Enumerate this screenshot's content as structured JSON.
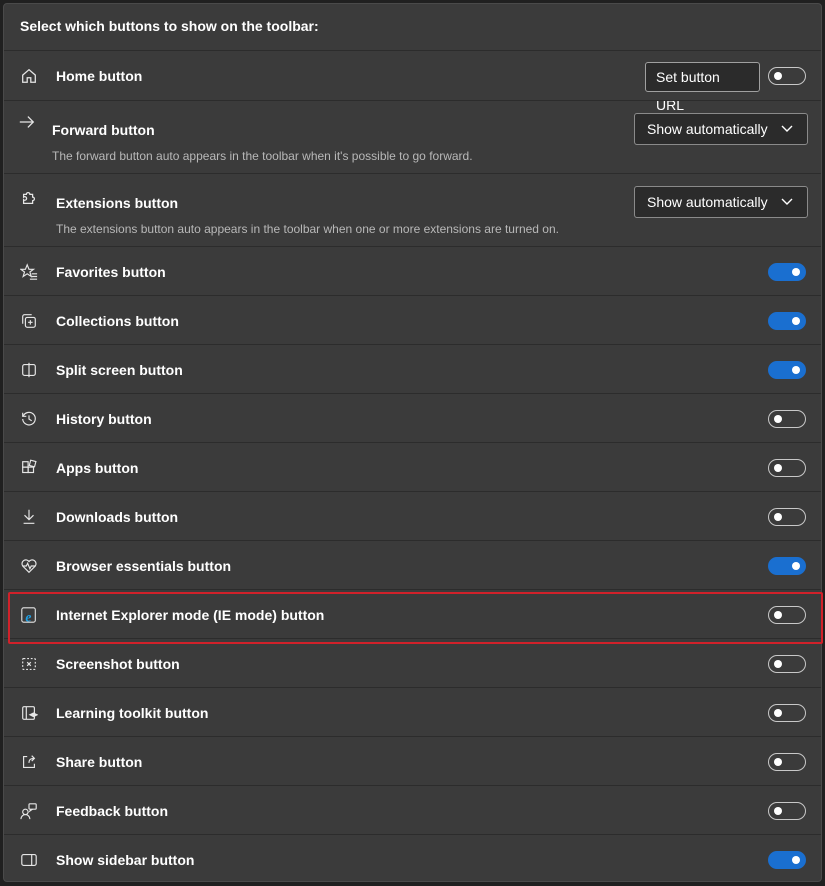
{
  "panel": {
    "title": "Select which buttons to show on the toolbar:"
  },
  "rows": [
    {
      "label": "Home button",
      "icon": "home-icon",
      "control": "toggle+button",
      "button_label": "Set button URL",
      "enabled": false
    },
    {
      "label": "Forward button",
      "icon": "arrow-right-icon",
      "control": "dropdown",
      "dropdown_value": "Show automatically",
      "description": "The forward button auto appears in the toolbar when it's possible to go forward."
    },
    {
      "label": "Extensions button",
      "icon": "puzzle-icon",
      "control": "dropdown",
      "dropdown_value": "Show automatically",
      "description": "The extensions button auto appears in the toolbar when one or more extensions are turned on."
    },
    {
      "label": "Favorites button",
      "icon": "star-list-icon",
      "control": "toggle",
      "enabled": true
    },
    {
      "label": "Collections button",
      "icon": "collections-icon",
      "control": "toggle",
      "enabled": true
    },
    {
      "label": "Split screen button",
      "icon": "split-screen-icon",
      "control": "toggle",
      "enabled": true
    },
    {
      "label": "History button",
      "icon": "history-icon",
      "control": "toggle",
      "enabled": false
    },
    {
      "label": "Apps button",
      "icon": "apps-icon",
      "control": "toggle",
      "enabled": false
    },
    {
      "label": "Downloads button",
      "icon": "download-icon",
      "control": "toggle",
      "enabled": false
    },
    {
      "label": "Browser essentials button",
      "icon": "heart-pulse-icon",
      "control": "toggle",
      "enabled": true
    },
    {
      "label": "Internet Explorer mode (IE mode) button",
      "icon": "internet-explorer-icon",
      "control": "toggle",
      "enabled": false,
      "highlighted": true
    },
    {
      "label": "Screenshot button",
      "icon": "screenshot-icon",
      "control": "toggle",
      "enabled": false
    },
    {
      "label": "Learning toolkit button",
      "icon": "learning-toolkit-icon",
      "control": "toggle",
      "enabled": false
    },
    {
      "label": "Share button",
      "icon": "share-icon",
      "control": "toggle",
      "enabled": false
    },
    {
      "label": "Feedback button",
      "icon": "feedback-icon",
      "control": "toggle",
      "enabled": false
    },
    {
      "label": "Show sidebar button",
      "icon": "sidebar-icon",
      "control": "toggle",
      "enabled": true
    }
  ],
  "colors": {
    "toggle_on": "#1a6fd0",
    "highlight_border": "#d1212a",
    "panel_bg": "#3b3b3b",
    "ie_icon": "#1ea1e6"
  }
}
